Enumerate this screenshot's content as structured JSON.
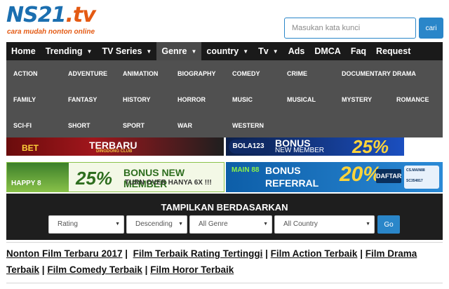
{
  "site": {
    "logo_main": "NS21",
    "logo_tld": ".tv",
    "tagline": "cara mudah nonton online"
  },
  "search": {
    "placeholder": "Masukan kata kunci",
    "button_label": "cari"
  },
  "nav": {
    "items": [
      "Home",
      "Trending",
      "TV Series",
      "Genre",
      "country",
      "Tv",
      "Ads",
      "DMCA",
      "Faq",
      "Request"
    ]
  },
  "genres": [
    "ACTION",
    "ADVENTURE",
    "ANIMATION",
    "BIOGRAPHY",
    "COMEDY",
    "CRIME",
    "DOCUMENTARY DRAMA",
    "FAMILY",
    "FANTASY",
    "HISTORY",
    "HORROR",
    "MUSIC",
    "MUSICAL",
    "MYSTERY",
    "ROMANCE",
    "SCI-FI",
    "SHORT",
    "SPORT",
    "WAR",
    "WESTERN"
  ],
  "banners": {
    "b1": {
      "brand": "BET",
      "title": "TERBARU",
      "sub": "DINGDONG CLUB"
    },
    "b2": {
      "brand": "BOLA123",
      "title": "BONUS",
      "sub": "NEW MEMBER",
      "percent": "25%"
    },
    "b3": {
      "brand": "HAPPY 8",
      "percent": "25%",
      "title": "BONUS NEW MEMBER",
      "sub": "TURN OVER HANYA 6X !!!"
    },
    "b4": {
      "brand": "MAIN 88",
      "line1": "BONUS",
      "line2": "REFERRAL",
      "percent": "20%",
      "button": "DAFTAR",
      "info1": "CS.MAIN88",
      "info2": "SC354817"
    }
  },
  "filter": {
    "title": "TAMPILKAN BERDASARKAN",
    "rating": "Rating",
    "order": "Descending",
    "genre": "All Genre",
    "country": "All Country",
    "go": "Go"
  },
  "links": {
    "l1": "Nonton Film Terbaru 2017",
    "l2": "Film Terbaik Rating Tertinggi",
    "l3": "Film Action Terbaik",
    "l4": "Film Drama Terbaik",
    "l5": "Film Comedy Terbaik",
    "l6": "Film Horor Terbaik",
    "sep": "|"
  }
}
